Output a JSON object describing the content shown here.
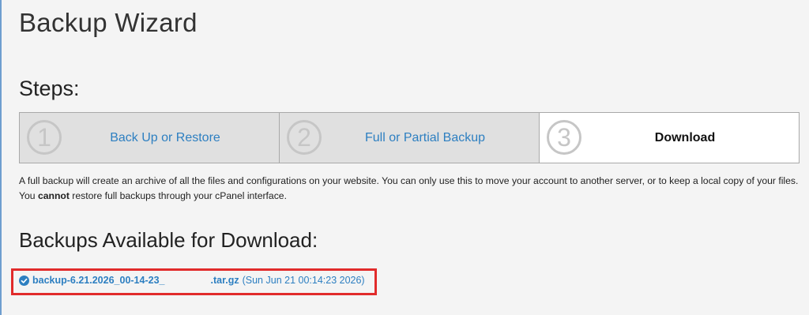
{
  "page": {
    "title": "Backup Wizard"
  },
  "steps": {
    "heading": "Steps:",
    "items": [
      {
        "number": "1",
        "label": "Back Up or Restore",
        "state": "completed"
      },
      {
        "number": "2",
        "label": "Full or Partial Backup",
        "state": "completed"
      },
      {
        "number": "3",
        "label": "Download",
        "state": "current"
      }
    ]
  },
  "description": {
    "part1": "A full backup will create an archive of all the files and configurations on your website. You can only use this to move your account to another server, or to keep a local copy of your files. You ",
    "emphasis": "cannot",
    "part2": " restore full backups through your cPanel interface."
  },
  "downloads": {
    "heading": "Backups Available for Download:",
    "items": [
      {
        "filename_prefix": "backup-6.21.2026_00-14-23_",
        "filename_suffix": ".tar.gz",
        "date": "(Sun Jun 21 00:14:23 2026)",
        "icon": "check-circle-icon"
      }
    ]
  },
  "colors": {
    "link": "#2d7fc1",
    "highlight": "#e12b2b",
    "step_inactive_bg": "#e0e0e0",
    "step_active_bg": "#ffffff"
  }
}
